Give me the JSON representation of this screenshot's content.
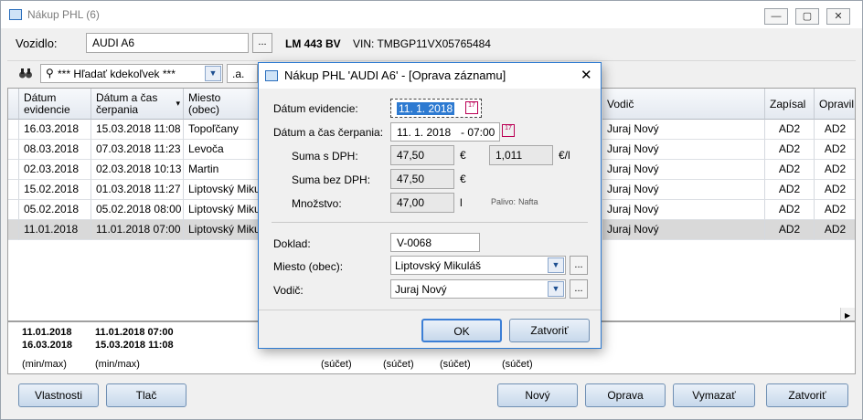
{
  "window": {
    "title": "Nákup PHL (6)",
    "min": "—",
    "max": "▢",
    "close": "✕"
  },
  "vehicle": {
    "label": "Vozidlo:",
    "name": "AUDI A6",
    "dots": "...",
    "plate": "LM 443 BV",
    "vin": "VIN: TMBGP11VX05765484"
  },
  "search": {
    "value": "*** Hľadať kdekoľvek ***",
    "mode": ".a."
  },
  "columns": {
    "evid": "Dátum evidencie",
    "cerp": "Dátum a čas čerpania",
    "miesto": "Miesto (obec)",
    "vodic": "Vodič",
    "zapisal": "Zapísal",
    "opravil": "Opravil"
  },
  "rows": [
    {
      "evid": "16.03.2018",
      "cerp": "15.03.2018 11:08",
      "miesto": "Topoľčany",
      "vodic": "Juraj Nový",
      "zapisal": "AD2",
      "opravil": "AD2"
    },
    {
      "evid": "08.03.2018",
      "cerp": "07.03.2018 11:23",
      "miesto": "Levoča",
      "vodic": "Juraj Nový",
      "zapisal": "AD2",
      "opravil": "AD2"
    },
    {
      "evid": "02.03.2018",
      "cerp": "02.03.2018 10:13",
      "miesto": "Martin",
      "vodic": "Juraj Nový",
      "zapisal": "AD2",
      "opravil": "AD2"
    },
    {
      "evid": "15.02.2018",
      "cerp": "01.03.2018 11:27",
      "miesto": "Liptovský Mikul",
      "vodic": "Juraj Nový",
      "zapisal": "AD2",
      "opravil": "AD2"
    },
    {
      "evid": "05.02.2018",
      "cerp": "05.02.2018 08:00",
      "miesto": "Liptovský Mikul",
      "vodic": "Juraj Nový",
      "zapisal": "AD2",
      "opravil": "AD2"
    },
    {
      "evid": "11.01.2018",
      "cerp": "11.01.2018 07:00",
      "miesto": "Liptovský Mikul",
      "vodic": "Juraj Nový",
      "zapisal": "AD2",
      "opravil": "AD2"
    }
  ],
  "footer": {
    "evid_min": "11.01.2018",
    "evid_max": "16.03.2018",
    "cerp_min": "11.01.2018 07:00",
    "cerp_max": "15.03.2018 11:08",
    "minmax": "(min/max)",
    "sucet": "(súčet)"
  },
  "buttons": {
    "vlastnosti": "Vlastnosti",
    "tlac": "Tlač",
    "novy": "Nový",
    "oprava": "Oprava",
    "vymazat": "Vymazať",
    "zatvorit": "Zatvoriť"
  },
  "dialog": {
    "title": "Nákup PHL 'AUDI A6' - [Oprava záznamu]",
    "datum_evid_label": "Dátum evidencie:",
    "datum_evid": "11. 1. 2018",
    "datum_cerp_label": "Dátum a čas čerpania:",
    "datum_cerp": "11. 1. 2018",
    "cas_cerp": "- 07:00",
    "suma_dph_label": "Suma s DPH:",
    "suma_dph": "47,50",
    "eur": "€",
    "cena": "1,011",
    "eur_l": "€/l",
    "suma_bez_label": "Suma bez DPH:",
    "suma_bez": "47,50",
    "mnozstvo_label": "Množstvo:",
    "mnozstvo": "47,00",
    "liter": "l",
    "palivo_label": "Palivo:",
    "palivo": "Nafta",
    "doklad_label": "Doklad:",
    "doklad": "V-0068",
    "miesto_label": "Miesto (obec):",
    "miesto": "Liptovský Mikuláš",
    "vodic_label": "Vodič:",
    "vodic": "Juraj Nový",
    "ok": "OK",
    "zatvorit": "Zatvoriť",
    "dots": "..."
  },
  "colors": {
    "accent": "#2d7ad1",
    "selected_row": "#d9d9d9"
  }
}
